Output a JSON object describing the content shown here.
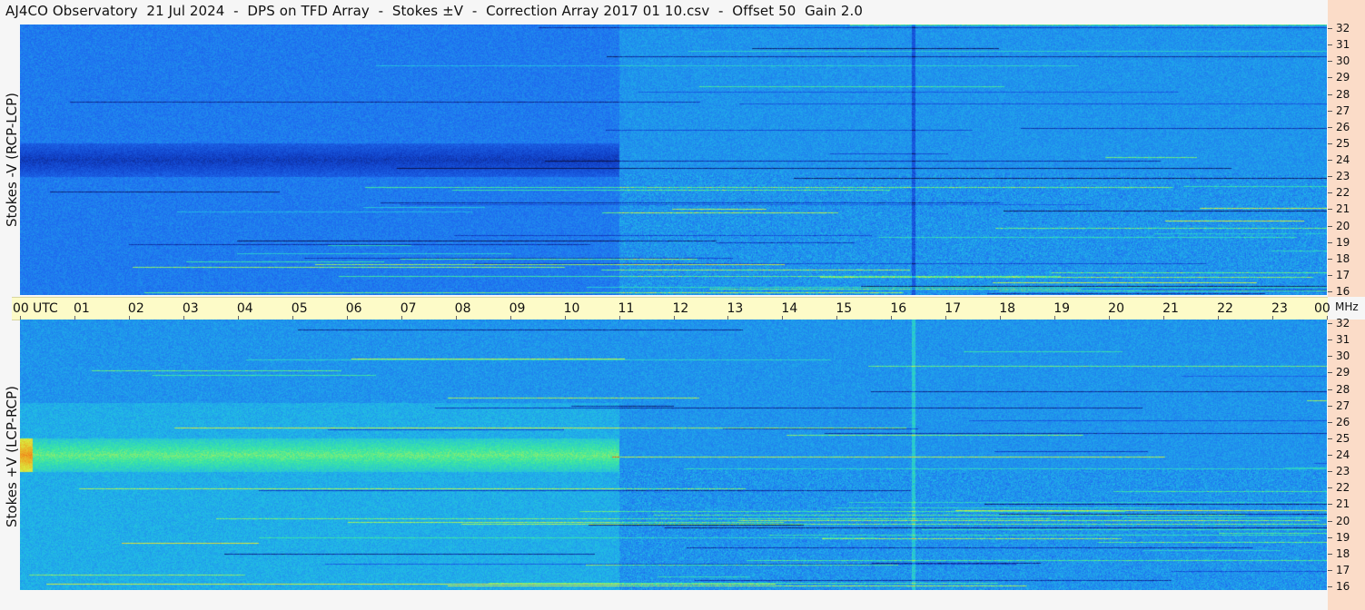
{
  "title": "AJ4CO Observatory  21 Jul 2024  -  DPS on TFD Array  -  Stokes ±V  -  Correction Array 2017 01 10.csv  -  Offset 50  Gain 2.0",
  "panels": [
    {
      "ylabel": "Stokes -V (RCP-LCP)"
    },
    {
      "ylabel": "Stokes +V (LCP-RCP)"
    }
  ],
  "time_axis": {
    "unit_label": "UTC",
    "ticks": [
      "00",
      "01",
      "02",
      "03",
      "04",
      "05",
      "06",
      "07",
      "08",
      "09",
      "10",
      "11",
      "12",
      "13",
      "14",
      "15",
      "16",
      "17",
      "18",
      "19",
      "20",
      "21",
      "22",
      "23",
      "00"
    ]
  },
  "freq_axis": {
    "unit_label": "MHz",
    "ticks": [
      "32",
      "31",
      "30",
      "29",
      "28",
      "27",
      "26",
      "25",
      "24",
      "23",
      "22",
      "21",
      "20",
      "19",
      "18",
      "17",
      "16"
    ]
  },
  "colors": {
    "background": "#f6f6f6",
    "time_bar": "#fdfbc8",
    "freq_bar": "#fbdcc8",
    "colormap": [
      "#0a1450",
      "#1040c8",
      "#1f6ef0",
      "#20b8e8",
      "#3ce8a0",
      "#d8f040",
      "#f0a020",
      "#e02010"
    ]
  },
  "chart_data": {
    "type": "heatmap",
    "x_range_utc_hours": [
      0,
      24
    ],
    "y_range_mhz": [
      16,
      32
    ],
    "series": [
      {
        "name": "Stokes -V (RCP-LCP)"
      },
      {
        "name": "Stokes +V (LCP-RCP)"
      }
    ],
    "features": {
      "daytime_dark_band_utc": [
        0,
        11
      ],
      "enhanced_band_mhz": [
        23,
        25
      ],
      "vertical_line_utc": 16.4
    }
  }
}
